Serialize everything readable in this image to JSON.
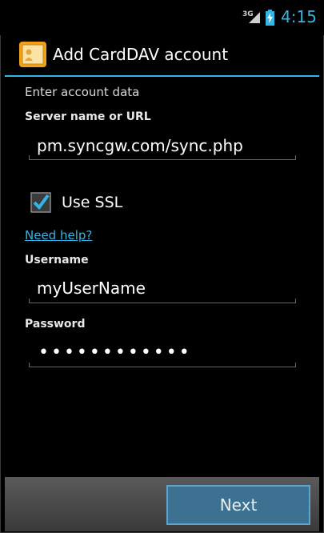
{
  "status_bar": {
    "network": "3G",
    "time": "4:15",
    "accent_color": "#33b5e5",
    "icons": [
      "signal-icon",
      "battery-charging-icon"
    ]
  },
  "action_bar": {
    "title": "Add CardDAV account",
    "icon": "contacts-app-icon"
  },
  "form": {
    "intro": "Enter account data",
    "server": {
      "label": "Server name or URL",
      "value": "pm.syncgw.com/sync.php"
    },
    "ssl": {
      "label": "Use SSL",
      "checked": true
    },
    "help_link": "Need help?",
    "username": {
      "label": "Username",
      "value": "myUserName"
    },
    "password": {
      "label": "Password",
      "value": "••••••••••••"
    }
  },
  "footer": {
    "next_label": "Next"
  }
}
